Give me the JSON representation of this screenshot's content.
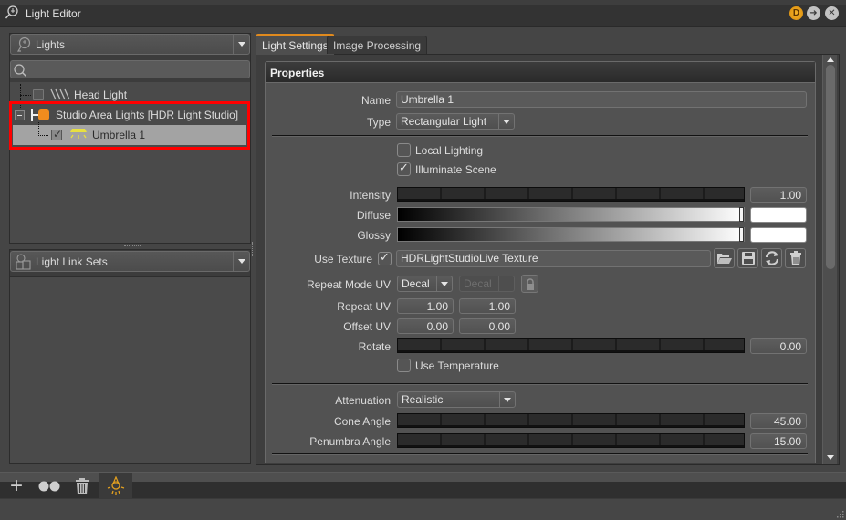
{
  "window": {
    "title": "Light Editor",
    "controls": [
      {
        "name": "dock",
        "glyph": "D"
      },
      {
        "name": "float",
        "glyph": "➜"
      },
      {
        "name": "close",
        "glyph": "✕"
      }
    ]
  },
  "left_panel": {
    "lights_combo": {
      "label": "Lights",
      "icon": "bulb-icon"
    },
    "search": {
      "value": "",
      "placeholder": ""
    },
    "tree": [
      {
        "label": "Head Light",
        "checked": false,
        "icon": "directional-light-icon",
        "level": 0
      },
      {
        "label": "Studio Area Lights [HDR Light Studio]",
        "expanded": true,
        "icon": "light-group-icon",
        "level": 0
      },
      {
        "label": "Umbrella 1",
        "checked": true,
        "icon": "area-light-icon",
        "level": 1,
        "selected": true
      }
    ],
    "link_sets_combo": {
      "label": "Light Link Sets",
      "icon": "light-link-sets-icon"
    }
  },
  "tabs": [
    {
      "label": "Light Settings",
      "active": true
    },
    {
      "label": "Image Processing",
      "active": false
    }
  ],
  "properties": {
    "header": "Properties",
    "name": {
      "label": "Name",
      "value": "Umbrella 1"
    },
    "type": {
      "label": "Type",
      "value": "Rectangular Light"
    },
    "local_lighting": {
      "label": "Local Lighting",
      "checked": false
    },
    "illuminate_scene": {
      "label": "Illuminate Scene",
      "checked": true
    },
    "intensity": {
      "label": "Intensity",
      "value": "1.00"
    },
    "diffuse": {
      "label": "Diffuse",
      "color": "#ffffff"
    },
    "glossy": {
      "label": "Glossy",
      "color": "#ffffff"
    },
    "use_texture": {
      "label": "Use Texture",
      "checked": true,
      "value": "HDRLightStudioLive Texture"
    },
    "repeat_mode_uv": {
      "label": "Repeat Mode UV",
      "u": "Decal",
      "v": "Decal"
    },
    "repeat_uv": {
      "label": "Repeat UV",
      "u": "1.00",
      "v": "1.00"
    },
    "offset_uv": {
      "label": "Offset UV",
      "u": "0.00",
      "v": "0.00"
    },
    "rotate": {
      "label": "Rotate",
      "value": "0.00"
    },
    "use_temperature": {
      "label": "Use Temperature",
      "checked": false
    },
    "attenuation": {
      "label": "Attenuation",
      "value": "Realistic"
    },
    "cone_angle": {
      "label": "Cone Angle",
      "value": "45.00"
    },
    "penumbra_angle": {
      "label": "Penumbra Angle",
      "value": "15.00"
    }
  },
  "bottom_toolbar": [
    {
      "name": "add",
      "glyph": "+"
    },
    {
      "name": "link",
      "glyph": "●●"
    },
    {
      "name": "delete",
      "glyph": "trash"
    },
    {
      "name": "light",
      "glyph": "bulb",
      "active": true,
      "color": "#e3a020"
    }
  ],
  "colors": {
    "accent": "#e08a1e",
    "highlight_box": "#ff0000",
    "group_icon": "#f08c1e",
    "area_light_icon": "#e8e040"
  }
}
